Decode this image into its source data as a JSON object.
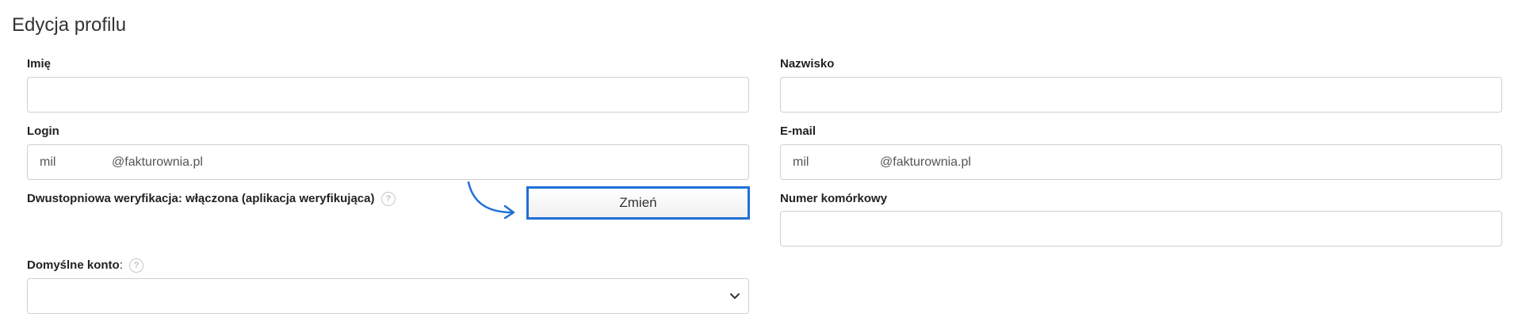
{
  "page": {
    "title": "Edycja profilu"
  },
  "form": {
    "first_name": {
      "label": "Imię",
      "value": ""
    },
    "last_name": {
      "label": "Nazwisko",
      "value": ""
    },
    "login": {
      "label": "Login",
      "value_prefix": "mil",
      "value_suffix": "@fakturownia.pl"
    },
    "email": {
      "label": "E-mail",
      "value_prefix": "mil",
      "value_suffix": "@fakturownia.pl"
    },
    "two_factor": {
      "label": "Dwustopniowa weryfikacja: włączona (aplikacja weryfikująca)",
      "help": "?",
      "button_label": "Zmień"
    },
    "mobile": {
      "label": "Numer komórkowy",
      "value": ""
    },
    "default_account": {
      "label": "Domyślne konto",
      "label_suffix": ":",
      "help": "?",
      "selected": ""
    }
  },
  "colors": {
    "accent": "#1f6fd6",
    "border": "#cfcfcf"
  },
  "icons": {
    "arrow": "curved-arrow-icon",
    "select": "chevron-down-icon",
    "help": "help-icon"
  }
}
